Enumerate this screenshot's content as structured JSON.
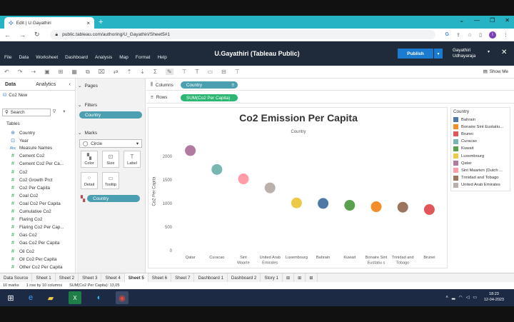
{
  "browser": {
    "tab_title": "Edit | U.Gayathiri",
    "new_tab_icon": "+",
    "url": "public.tableau.com/authoring/U_Gayathiri/Sheet5#1"
  },
  "app": {
    "menus": [
      "File",
      "Data",
      "Worksheet",
      "Dashboard",
      "Analysis",
      "Map",
      "Format",
      "Help"
    ],
    "title": "U.Gayathiri (Tableau Public)",
    "publish_label": "Publish",
    "user_line1": "Gayathiri",
    "user_line2": "Udhayaraja",
    "show_me_label": "Show Me"
  },
  "data_pane": {
    "tabs": [
      "Data",
      "Analytics"
    ],
    "datasource": "Co2 New",
    "search_placeholder": "Search",
    "tables_label": "Tables",
    "fields": [
      {
        "icon": "globe-icon",
        "label": "Country",
        "kind": "dim"
      },
      {
        "icon": "calendar-icon",
        "label": "Year",
        "kind": "dim"
      },
      {
        "icon": "abc-icon",
        "label": "Measure Names",
        "kind": "dim"
      },
      {
        "icon": "measure-icon",
        "label": "Cement Co2",
        "kind": "mea"
      },
      {
        "icon": "measure-icon",
        "label": "Cement Co2 Per Ca...",
        "kind": "mea"
      },
      {
        "icon": "measure-icon",
        "label": "Co2",
        "kind": "mea"
      },
      {
        "icon": "measure-icon",
        "label": "Co2 Growth Prct",
        "kind": "mea"
      },
      {
        "icon": "measure-icon",
        "label": "Co2 Per Capita",
        "kind": "mea"
      },
      {
        "icon": "measure-icon",
        "label": "Coal Co2",
        "kind": "mea"
      },
      {
        "icon": "measure-icon",
        "label": "Coal Co2 Per Capita",
        "kind": "mea"
      },
      {
        "icon": "measure-icon",
        "label": "Cumulative Co2",
        "kind": "mea"
      },
      {
        "icon": "measure-icon",
        "label": "Flaring Co2",
        "kind": "mea"
      },
      {
        "icon": "measure-icon",
        "label": "Flaring Co2 Per Cap...",
        "kind": "mea"
      },
      {
        "icon": "measure-icon",
        "label": "Gas Co2",
        "kind": "mea"
      },
      {
        "icon": "measure-icon",
        "label": "Gas Co2 Per Capita",
        "kind": "mea"
      },
      {
        "icon": "measure-icon",
        "label": "Oil Co2",
        "kind": "mea"
      },
      {
        "icon": "measure-icon",
        "label": "Oil Co2 Per Capita",
        "kind": "mea"
      },
      {
        "icon": "measure-icon",
        "label": "Other Co2 Per Capita",
        "kind": "mea"
      }
    ]
  },
  "shelves": {
    "pages_label": "Pages",
    "filters_label": "Filters",
    "filter_pill": "Country",
    "marks_label": "Marks",
    "mark_type": "Circle",
    "mark_buttons": [
      "Color",
      "Size",
      "Label",
      "Detail",
      "Tooltip"
    ],
    "marks_pill": "Country",
    "columns_label": "Columns",
    "columns_pill": "Country",
    "rows_label": "Rows",
    "rows_pill": "SUM(Co2 Per Capita)"
  },
  "legend": {
    "title": "Country",
    "items": [
      {
        "label": "Bahrain",
        "color": "#4e79a7"
      },
      {
        "label": "Bonaire Sint Eustatiu...",
        "color": "#f28e2b"
      },
      {
        "label": "Brunei",
        "color": "#e15759"
      },
      {
        "label": "Curacao",
        "color": "#76b7b2"
      },
      {
        "label": "Kuwait",
        "color": "#59a14f"
      },
      {
        "label": "Luxembourg",
        "color": "#edc948"
      },
      {
        "label": "Qatar",
        "color": "#b07aa1"
      },
      {
        "label": "Sint Maarten (Dutch ...",
        "color": "#ff9da7"
      },
      {
        "label": "Trinidad and Tobago",
        "color": "#9c755f"
      },
      {
        "label": "United Arab Emirates",
        "color": "#bab0ac"
      }
    ]
  },
  "chart_data": {
    "type": "scatter",
    "title": "Co2 Emission Per Capita",
    "subtitle": "Country",
    "ylabel": "Co2 Per Capita",
    "ylim": [
      0,
      2300
    ],
    "yticks": [
      0,
      500,
      1000,
      1500,
      2000
    ],
    "categories": [
      "Qatar",
      "Curacao",
      "Sint Maarte",
      "United Arab Emirates",
      "Luxembourg",
      "Bahrain",
      "Kuwait",
      "Bonaire Sint Eustatiu s",
      "Trinidad and Tobago",
      "Brunei"
    ],
    "category_lines": [
      [
        "Qatar"
      ],
      [
        "Curacao"
      ],
      [
        "Sint",
        "Maarte"
      ],
      [
        "United Arab",
        "Emirates"
      ],
      [
        "Luxembourg"
      ],
      [
        "Bahrain"
      ],
      [
        "Kuwait"
      ],
      [
        "Bonaire Sint",
        "Eustatiu s"
      ],
      [
        "Trinidad and",
        "Tobago"
      ],
      [
        "Brunei"
      ]
    ],
    "values": [
      2120,
      1720,
      1520,
      1330,
      1010,
      1000,
      960,
      930,
      920,
      870
    ],
    "colors": [
      "#b07aa1",
      "#76b7b2",
      "#ff9da7",
      "#bab0ac",
      "#edc948",
      "#4e79a7",
      "#59a14f",
      "#f28e2b",
      "#9c755f",
      "#e15759"
    ]
  },
  "sheet_tabs": [
    "Data Source",
    "Sheet 1",
    "Sheet 2",
    "Sheet 3",
    "Sheet 4",
    "Sheet 5",
    "Sheet 6",
    "Sheet 7",
    "Dashboard 1",
    "Dashboard 2",
    "Story 1"
  ],
  "active_sheet": "Sheet 5",
  "status": {
    "marks": "10 marks",
    "rows_cols": "1 row by 10 columns",
    "sum": "SUM(Co2 Per Capita): 13,05"
  },
  "taskbar": {
    "time": "18:23",
    "date": "12-04-2023"
  }
}
